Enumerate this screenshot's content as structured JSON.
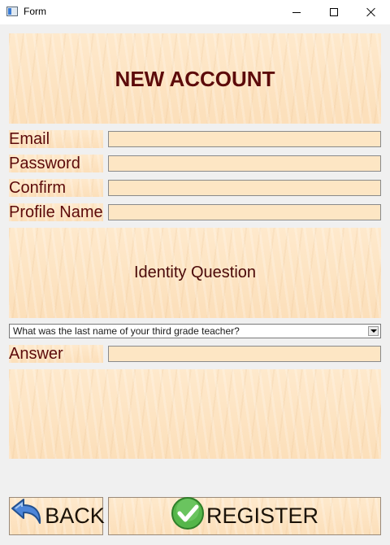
{
  "window": {
    "title": "Form",
    "icons": {
      "app": "window-app-icon",
      "minimize": "minimize-icon",
      "maximize": "maximize-icon",
      "close": "close-icon"
    }
  },
  "header": {
    "title": "NEW ACCOUNT"
  },
  "fields": {
    "email": {
      "label": "Email",
      "value": ""
    },
    "password": {
      "label": "Password",
      "value": ""
    },
    "confirm": {
      "label": "Confirm",
      "value": ""
    },
    "profile_name": {
      "label": "Profile Name",
      "value": ""
    }
  },
  "identity": {
    "heading": "Identity Question",
    "selected_question": "What was the last name of your third grade teacher?",
    "answer": {
      "label": "Answer",
      "value": ""
    }
  },
  "message": "",
  "buttons": {
    "back": {
      "label": "BACK",
      "icon": "back-arrow-icon",
      "icon_color": "#3a6fc4"
    },
    "register": {
      "label": "REGISTER",
      "icon": "checkmark-icon",
      "icon_color": "#3ea43a"
    }
  },
  "colors": {
    "label_text": "#5c0a0a",
    "panel_wood": "#fde6c4",
    "window_bg": "#f0f0f0"
  }
}
